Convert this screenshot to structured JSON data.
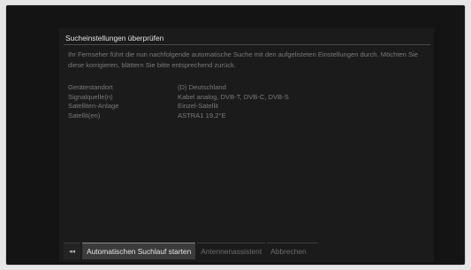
{
  "dialog": {
    "title": "Sucheinstellungen überprüfen",
    "intro": "Ihr Fernseher führt die nun nachfolgende automatische Suche mit den aufgelisteten Einstellungen durch. Möchten Sie diese korrigieren, blättern Sie bitte entsprechend zurück.",
    "settings": [
      {
        "label": "Gerätestandort",
        "value": "(D) Deutschland"
      },
      {
        "label": "Signalquelle(n)",
        "value": "Kabel analog, DVB-T, DVB-C, DVB-S"
      },
      {
        "label": "Satelliten-Anlage",
        "value": "Einzel-Satellit"
      },
      {
        "label": "Satellit(en)",
        "value": "ASTRA1 19,2°E"
      }
    ]
  },
  "footer": {
    "back_icon": "double-left-arrow-icon",
    "back_glyph": "◂◂",
    "buttons": [
      {
        "label": "Automatischen Suchlauf starten",
        "active": true
      },
      {
        "label": "Antennenassistent",
        "active": false
      },
      {
        "label": "Abbrechen",
        "active": false
      }
    ]
  },
  "colors": {
    "background": "#141414",
    "panel": "#1b1b1b",
    "active_button": "#3b3b3b",
    "text_bright": "#e2e2e2",
    "text_dim": "#7a7a7a"
  }
}
